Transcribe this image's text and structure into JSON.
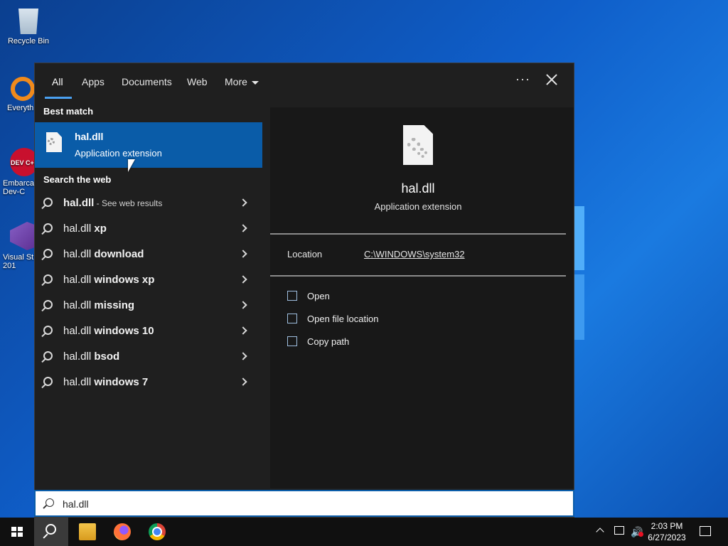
{
  "desktop": {
    "icons": [
      {
        "label": "Recycle Bin"
      },
      {
        "label": "Everyth"
      },
      {
        "label": "Embarca Dev-C"
      },
      {
        "label": "Visual St 201"
      }
    ],
    "devcpp_logo_text": "DEV C++"
  },
  "flyout": {
    "tabs": [
      {
        "label": "All"
      },
      {
        "label": "Apps"
      },
      {
        "label": "Documents"
      },
      {
        "label": "Web"
      },
      {
        "label": "More"
      }
    ],
    "ellipsis": "···",
    "best_match_heading": "Best match",
    "best_match": {
      "title": "hal.dll",
      "subtitle": "Application extension"
    },
    "web_heading": "Search the web",
    "web_results": [
      {
        "base": "hal.dll",
        "suffix": "",
        "hint": " - See web results"
      },
      {
        "base": "hal.dll",
        "suffix": " xp",
        "hint": ""
      },
      {
        "base": "hal.dll",
        "suffix": " download",
        "hint": ""
      },
      {
        "base": "hal.dll",
        "suffix": " windows xp",
        "hint": ""
      },
      {
        "base": "hal.dll",
        "suffix": " missing",
        "hint": ""
      },
      {
        "base": "hal.dll",
        "suffix": " windows 10",
        "hint": ""
      },
      {
        "base": "hal.dll",
        "suffix": " bsod",
        "hint": ""
      },
      {
        "base": "hal.dll",
        "suffix": " windows 7",
        "hint": ""
      }
    ],
    "preview": {
      "title": "hal.dll",
      "subtitle": "Application extension",
      "location_label": "Location",
      "location_value": "C:\\WINDOWS\\system32",
      "actions": [
        {
          "label": "Open"
        },
        {
          "label": "Open file location"
        },
        {
          "label": "Copy path"
        }
      ]
    }
  },
  "search": {
    "value": "hal.dll"
  },
  "taskbar": {
    "time": "2:03 PM",
    "date": "6/27/2023"
  }
}
